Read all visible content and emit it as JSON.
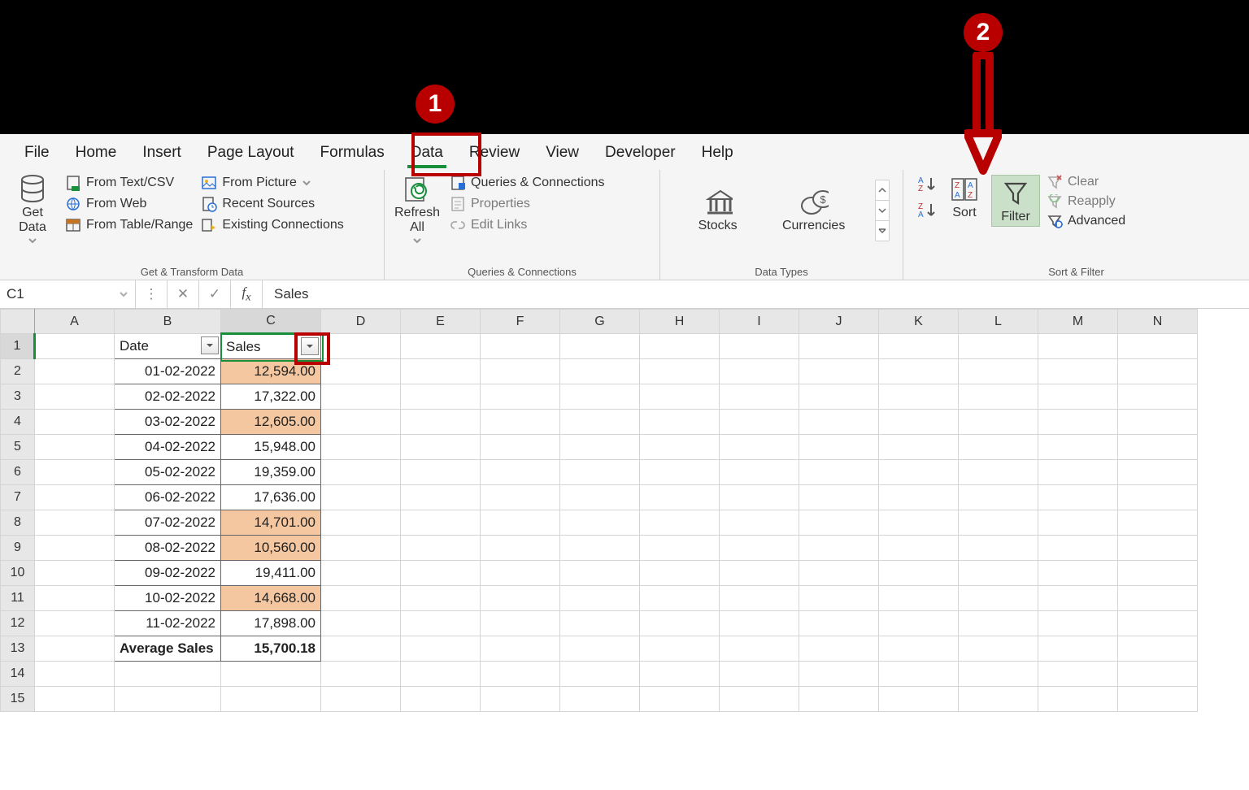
{
  "tabs": [
    "File",
    "Home",
    "Insert",
    "Page Layout",
    "Formulas",
    "Data",
    "Review",
    "View",
    "Developer",
    "Help"
  ],
  "active_tab": "Data",
  "annotations": {
    "badge1": "1",
    "badge2": "2"
  },
  "ribbon": {
    "get_transform": {
      "label": "Get & Transform Data",
      "get_data": "Get\nData",
      "from_text": "From Text/CSV",
      "from_web": "From Web",
      "from_table": "From Table/Range",
      "from_picture": "From Picture",
      "recent": "Recent Sources",
      "existing": "Existing Connections"
    },
    "queries": {
      "label": "Queries & Connections",
      "refresh": "Refresh\nAll",
      "qc": "Queries & Connections",
      "props": "Properties",
      "links": "Edit Links"
    },
    "datatypes": {
      "label": "Data Types",
      "stocks": "Stocks",
      "currencies": "Currencies"
    },
    "sortfilter": {
      "label": "Sort & Filter",
      "sort": "Sort",
      "filter": "Filter",
      "clear": "Clear",
      "reapply": "Reapply",
      "advanced": "Advanced"
    }
  },
  "formula_bar": {
    "cell": "C1",
    "value": "Sales"
  },
  "columns": [
    "A",
    "B",
    "C",
    "D",
    "E",
    "F",
    "G",
    "H",
    "I",
    "J",
    "K",
    "L",
    "M",
    "N"
  ],
  "headers": {
    "b": "Date",
    "c": "Sales"
  },
  "rows": [
    {
      "n": 1
    },
    {
      "n": 2,
      "date": "01-02-2022",
      "sales": "12,594.00",
      "hl": true
    },
    {
      "n": 3,
      "date": "02-02-2022",
      "sales": "17,322.00",
      "hl": false
    },
    {
      "n": 4,
      "date": "03-02-2022",
      "sales": "12,605.00",
      "hl": true
    },
    {
      "n": 5,
      "date": "04-02-2022",
      "sales": "15,948.00",
      "hl": false
    },
    {
      "n": 6,
      "date": "05-02-2022",
      "sales": "19,359.00",
      "hl": false
    },
    {
      "n": 7,
      "date": "06-02-2022",
      "sales": "17,636.00",
      "hl": false
    },
    {
      "n": 8,
      "date": "07-02-2022",
      "sales": "14,701.00",
      "hl": true
    },
    {
      "n": 9,
      "date": "08-02-2022",
      "sales": "10,560.00",
      "hl": true
    },
    {
      "n": 10,
      "date": "09-02-2022",
      "sales": "19,411.00",
      "hl": false
    },
    {
      "n": 11,
      "date": "10-02-2022",
      "sales": "14,668.00",
      "hl": true
    },
    {
      "n": 12,
      "date": "11-02-2022",
      "sales": "17,898.00",
      "hl": false
    },
    {
      "n": 13,
      "label": "Average Sales",
      "avg": "15,700.18"
    },
    {
      "n": 14
    },
    {
      "n": 15
    }
  ]
}
